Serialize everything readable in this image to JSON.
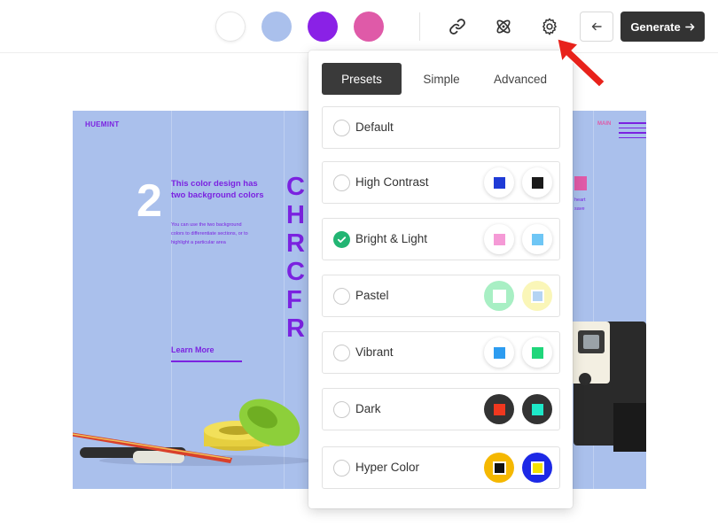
{
  "toolbar": {
    "swatches": [
      {
        "name": "white",
        "color": "#ffffff"
      },
      {
        "name": "periwinkle",
        "color": "#aac0ec"
      },
      {
        "name": "violet",
        "color": "#8a21e6"
      },
      {
        "name": "pink",
        "color": "#df5aa8"
      }
    ],
    "icons": [
      "link-icon",
      "atom-icon",
      "gear-icon"
    ],
    "back_icon": "arrow-left-icon",
    "generate_label": "Generate",
    "generate_icon": "arrow-right-icon"
  },
  "preview": {
    "logo": "HUEMINT",
    "nav_main": "MAIN",
    "step_number": "2",
    "heading": "This color design has two background colors",
    "body": "You can use the two background colors to differentiate sections, or to highlight a particular area",
    "big_letters": [
      "C",
      "H",
      "R",
      "C",
      "F",
      "R"
    ],
    "learn_more": "Learn More",
    "side_text": [
      "heart",
      "save"
    ],
    "colors": {
      "background": "#aac0ec",
      "accent": "#7b22e0",
      "pink": "#e05aa8",
      "white": "#ffffff"
    }
  },
  "settings": {
    "tabs": [
      {
        "label": "Presets",
        "active": true
      },
      {
        "label": "Simple",
        "active": false
      },
      {
        "label": "Advanced",
        "active": false
      }
    ],
    "presets": [
      {
        "label": "Default",
        "selected": false,
        "chips": []
      },
      {
        "label": "High Contrast",
        "selected": false,
        "chips": [
          {
            "bg": "#ffffff",
            "fg": "#1f3bd6",
            "style": "light"
          },
          {
            "bg": "#ffffff",
            "fg": "#1a1a1a",
            "style": "light"
          }
        ]
      },
      {
        "label": "Bright & Light",
        "selected": true,
        "chips": [
          {
            "bg": "#ffffff",
            "fg": "#f59ad6",
            "style": "light"
          },
          {
            "bg": "#ffffff",
            "fg": "#6ec6f5",
            "style": "light"
          }
        ]
      },
      {
        "label": "Pastel",
        "selected": false,
        "chips": [
          {
            "bg": "#a8efc4",
            "fg": "#ffffff",
            "style": "bordered"
          },
          {
            "bg": "#faf6b8",
            "fg": "#b4d4f4",
            "style": "bordered"
          }
        ]
      },
      {
        "label": "Vibrant",
        "selected": false,
        "chips": [
          {
            "bg": "#ffffff",
            "fg": "#2d9cf0",
            "style": "light"
          },
          {
            "bg": "#ffffff",
            "fg": "#1fd67a",
            "style": "light"
          }
        ]
      },
      {
        "label": "Dark",
        "selected": false,
        "chips": [
          {
            "bg": "#333333",
            "fg": "#f0381f",
            "style": "dark"
          },
          {
            "bg": "#333333",
            "fg": "#1ee8c8",
            "style": "dark"
          }
        ]
      },
      {
        "label": "Hyper Color",
        "selected": false,
        "chips": [
          {
            "bg": "#f5b800",
            "fg": "#111111",
            "style": "bordered"
          },
          {
            "bg": "#1d29e6",
            "fg": "#f5e200",
            "style": "bordered"
          }
        ]
      }
    ]
  },
  "annotation": {
    "arrow_color": "#e8221b"
  }
}
